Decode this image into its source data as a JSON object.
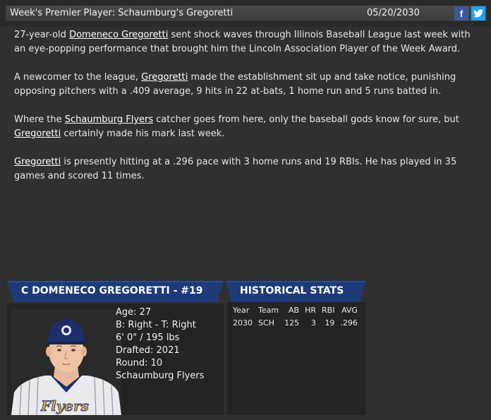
{
  "header": {
    "title": "Week's Premier Player: Schaumburg's Gregoretti",
    "date": "05/20/2030",
    "facebook_glyph": "f",
    "twitter_glyph": "🐦"
  },
  "article": {
    "p1_pre": "27-year-old ",
    "p1_link": "Domeneco Gregoretti",
    "p1_post": " sent shock waves through Illinois Baseball League last week with an eye-popping performance that brought him the Lincoln Association Player of the Week Award.",
    "p2_pre": "A newcomer to the league, ",
    "p2_link": "Gregoretti",
    "p2_post": " made the establishment sit up and take notice, punishing opposing pitchers with a .409 average, 9 hits in 22 at-bats, 1 home run and 5 runs batted in.",
    "p3_pre": "Where the ",
    "p3_link1": "Schaumburg Flyers",
    "p3_mid": " catcher goes from here, only the baseball gods know for sure, but ",
    "p3_link2": "Gregoretti",
    "p3_post": " certainly made his mark last week.",
    "p4_link": "Gregoretti",
    "p4_post": " is presently hitting at a .296 pace with 3 home runs and 19 RBIs. He has played in 35 games and scored 11 times."
  },
  "player": {
    "banner": "C DOMENECO GREGORETTI - #19",
    "age": "Age: 27",
    "bats_throws": "B: Right - T: Right",
    "height_weight": "6' 0\" / 195 lbs",
    "drafted": "Drafted: 2021",
    "round": "Round: 10",
    "team": "Schaumburg Flyers",
    "jersey_text": "Flyers"
  },
  "stats": {
    "banner": "HISTORICAL STATS",
    "headers": [
      "Year",
      "Team",
      "AB",
      "HR",
      "RBI",
      "AVG"
    ],
    "rows": [
      [
        "2030",
        "SCH",
        "125",
        "3",
        "19",
        ".296"
      ]
    ]
  },
  "colors": {
    "banner": "#1f3a78",
    "background": "#303030",
    "facebook": "#3b5998",
    "twitter": "#1da1f2"
  }
}
